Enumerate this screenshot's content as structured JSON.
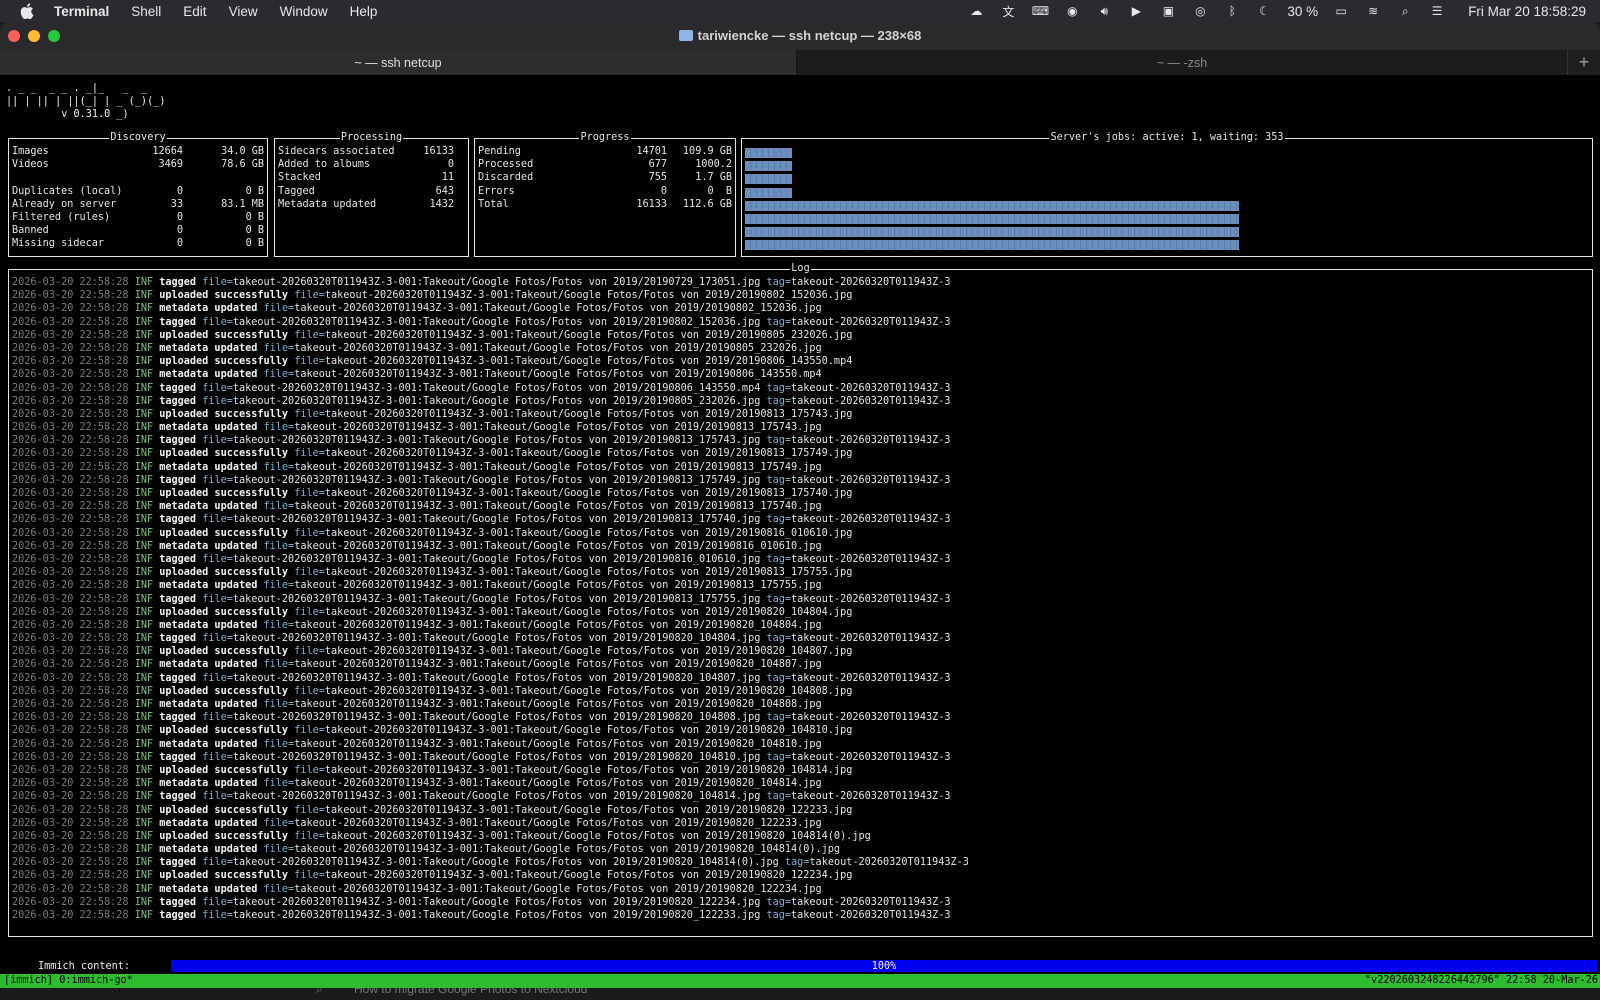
{
  "menubar": {
    "app": "Terminal",
    "items": [
      "Shell",
      "Edit",
      "View",
      "Window",
      "Help"
    ],
    "battery": "30 %",
    "clock": "Fri Mar 20  18:58:29"
  },
  "window": {
    "title": "tariwiencke — ssh netcup — 238×68",
    "tabs": [
      {
        "label": "~ — ssh netcup",
        "active": true
      },
      {
        "label": "~ — -zsh",
        "active": false
      }
    ],
    "add_tab": "+"
  },
  "logo": [
    ". _ _  _ _ . _|_   _  _",
    "|| | || | ||(_| | _ (_)(_)",
    "         v 0.31.0 _)"
  ],
  "discovery": {
    "title": "Discovery",
    "rows": [
      {
        "label": "Images",
        "count": "12664",
        "size": "34.0 GB"
      },
      {
        "label": "Videos",
        "count": "3469",
        "size": "78.6 GB"
      },
      {
        "label": "",
        "count": "",
        "size": ""
      },
      {
        "label": "Duplicates (local)",
        "count": "0",
        "size": "0 B"
      },
      {
        "label": "Already on server",
        "count": "33",
        "size": "83.1 MB"
      },
      {
        "label": "Filtered (rules)",
        "count": "0",
        "size": "0 B"
      },
      {
        "label": "Banned",
        "count": "0",
        "size": "0 B"
      },
      {
        "label": "Missing sidecar",
        "count": "0",
        "size": "0 B"
      }
    ]
  },
  "processing": {
    "title": "Processing",
    "rows": [
      {
        "label": "Sidecars associated",
        "count": "16133"
      },
      {
        "label": "Added to albums",
        "count": "0"
      },
      {
        "label": "Stacked",
        "count": "11"
      },
      {
        "label": "Tagged",
        "count": "643"
      },
      {
        "label": "Metadata updated",
        "count": "1432"
      }
    ]
  },
  "progress": {
    "title": "Progress",
    "rows": [
      {
        "label": "Pending",
        "count": "14701",
        "size": "109.9 GB"
      },
      {
        "label": "Processed",
        "count": "677",
        "size": "1000.2"
      },
      {
        "label": "Discarded",
        "count": "755",
        "size": "1.7 GB"
      },
      {
        "label": "Errors",
        "count": "0",
        "size": "0  B"
      },
      {
        "label": "Total",
        "count": "16133",
        "size": "112.6 GB"
      }
    ]
  },
  "jobs": {
    "title": "Server's jobs: active: 1, waiting: 353",
    "bar_levels": [
      0.095,
      0.095,
      0.095,
      0.095,
      1.0,
      1.0,
      1.0,
      1.0
    ]
  },
  "log": {
    "title": "Log",
    "timestamp": "2026-03-20 22:58:28",
    "level": "INF",
    "lines": [
      {
        "msg": "tagged",
        "file": "takeout-20260320T011943Z-3-001:Takeout/Google Fotos/Fotos von 2019/20190729_173051.jpg",
        "tag": "takeout-20260320T011943Z-3"
      },
      {
        "msg": "uploaded successfully",
        "file": "takeout-20260320T011943Z-3-001:Takeout/Google Fotos/Fotos von 2019/20190802_152036.jpg",
        "tag": ""
      },
      {
        "msg": "metadata updated",
        "file": "takeout-20260320T011943Z-3-001:Takeout/Google Fotos/Fotos von 2019/20190802_152036.jpg",
        "tag": ""
      },
      {
        "msg": "tagged",
        "file": "takeout-20260320T011943Z-3-001:Takeout/Google Fotos/Fotos von 2019/20190802_152036.jpg",
        "tag": "takeout-20260320T011943Z-3"
      },
      {
        "msg": "uploaded successfully",
        "file": "takeout-20260320T011943Z-3-001:Takeout/Google Fotos/Fotos von 2019/20190805_232026.jpg",
        "tag": ""
      },
      {
        "msg": "metadata updated",
        "file": "takeout-20260320T011943Z-3-001:Takeout/Google Fotos/Fotos von 2019/20190805_232026.jpg",
        "tag": ""
      },
      {
        "msg": "uploaded successfully",
        "file": "takeout-20260320T011943Z-3-001:Takeout/Google Fotos/Fotos von 2019/20190806_143550.mp4",
        "tag": ""
      },
      {
        "msg": "metadata updated",
        "file": "takeout-20260320T011943Z-3-001:Takeout/Google Fotos/Fotos von 2019/20190806_143550.mp4",
        "tag": ""
      },
      {
        "msg": "tagged",
        "file": "takeout-20260320T011943Z-3-001:Takeout/Google Fotos/Fotos von 2019/20190806_143550.mp4",
        "tag": "takeout-20260320T011943Z-3"
      },
      {
        "msg": "tagged",
        "file": "takeout-20260320T011943Z-3-001:Takeout/Google Fotos/Fotos von 2019/20190805_232026.jpg",
        "tag": "takeout-20260320T011943Z-3"
      },
      {
        "msg": "uploaded successfully",
        "file": "takeout-20260320T011943Z-3-001:Takeout/Google Fotos/Fotos von 2019/20190813_175743.jpg",
        "tag": ""
      },
      {
        "msg": "metadata updated",
        "file": "takeout-20260320T011943Z-3-001:Takeout/Google Fotos/Fotos von 2019/20190813_175743.jpg",
        "tag": ""
      },
      {
        "msg": "tagged",
        "file": "takeout-20260320T011943Z-3-001:Takeout/Google Fotos/Fotos von 2019/20190813_175743.jpg",
        "tag": "takeout-20260320T011943Z-3"
      },
      {
        "msg": "uploaded successfully",
        "file": "takeout-20260320T011943Z-3-001:Takeout/Google Fotos/Fotos von 2019/20190813_175749.jpg",
        "tag": ""
      },
      {
        "msg": "metadata updated",
        "file": "takeout-20260320T011943Z-3-001:Takeout/Google Fotos/Fotos von 2019/20190813_175749.jpg",
        "tag": ""
      },
      {
        "msg": "tagged",
        "file": "takeout-20260320T011943Z-3-001:Takeout/Google Fotos/Fotos von 2019/20190813_175749.jpg",
        "tag": "takeout-20260320T011943Z-3"
      },
      {
        "msg": "uploaded successfully",
        "file": "takeout-20260320T011943Z-3-001:Takeout/Google Fotos/Fotos von 2019/20190813_175740.jpg",
        "tag": ""
      },
      {
        "msg": "metadata updated",
        "file": "takeout-20260320T011943Z-3-001:Takeout/Google Fotos/Fotos von 2019/20190813_175740.jpg",
        "tag": ""
      },
      {
        "msg": "tagged",
        "file": "takeout-20260320T011943Z-3-001:Takeout/Google Fotos/Fotos von 2019/20190813_175740.jpg",
        "tag": "takeout-20260320T011943Z-3"
      },
      {
        "msg": "uploaded successfully",
        "file": "takeout-20260320T011943Z-3-001:Takeout/Google Fotos/Fotos von 2019/20190816_010610.jpg",
        "tag": ""
      },
      {
        "msg": "metadata updated",
        "file": "takeout-20260320T011943Z-3-001:Takeout/Google Fotos/Fotos von 2019/20190816_010610.jpg",
        "tag": ""
      },
      {
        "msg": "tagged",
        "file": "takeout-20260320T011943Z-3-001:Takeout/Google Fotos/Fotos von 2019/20190816_010610.jpg",
        "tag": "takeout-20260320T011943Z-3"
      },
      {
        "msg": "uploaded successfully",
        "file": "takeout-20260320T011943Z-3-001:Takeout/Google Fotos/Fotos von 2019/20190813_175755.jpg",
        "tag": ""
      },
      {
        "msg": "metadata updated",
        "file": "takeout-20260320T011943Z-3-001:Takeout/Google Fotos/Fotos von 2019/20190813_175755.jpg",
        "tag": ""
      },
      {
        "msg": "tagged",
        "file": "takeout-20260320T011943Z-3-001:Takeout/Google Fotos/Fotos von 2019/20190813_175755.jpg",
        "tag": "takeout-20260320T011943Z-3"
      },
      {
        "msg": "uploaded successfully",
        "file": "takeout-20260320T011943Z-3-001:Takeout/Google Fotos/Fotos von 2019/20190820_104804.jpg",
        "tag": ""
      },
      {
        "msg": "metadata updated",
        "file": "takeout-20260320T011943Z-3-001:Takeout/Google Fotos/Fotos von 2019/20190820_104804.jpg",
        "tag": ""
      },
      {
        "msg": "tagged",
        "file": "takeout-20260320T011943Z-3-001:Takeout/Google Fotos/Fotos von 2019/20190820_104804.jpg",
        "tag": "takeout-20260320T011943Z-3"
      },
      {
        "msg": "uploaded successfully",
        "file": "takeout-20260320T011943Z-3-001:Takeout/Google Fotos/Fotos von 2019/20190820_104807.jpg",
        "tag": ""
      },
      {
        "msg": "metadata updated",
        "file": "takeout-20260320T011943Z-3-001:Takeout/Google Fotos/Fotos von 2019/20190820_104807.jpg",
        "tag": ""
      },
      {
        "msg": "tagged",
        "file": "takeout-20260320T011943Z-3-001:Takeout/Google Fotos/Fotos von 2019/20190820_104807.jpg",
        "tag": "takeout-20260320T011943Z-3"
      },
      {
        "msg": "uploaded successfully",
        "file": "takeout-20260320T011943Z-3-001:Takeout/Google Fotos/Fotos von 2019/20190820_104808.jpg",
        "tag": ""
      },
      {
        "msg": "metadata updated",
        "file": "takeout-20260320T011943Z-3-001:Takeout/Google Fotos/Fotos von 2019/20190820_104808.jpg",
        "tag": ""
      },
      {
        "msg": "tagged",
        "file": "takeout-20260320T011943Z-3-001:Takeout/Google Fotos/Fotos von 2019/20190820_104808.jpg",
        "tag": "takeout-20260320T011943Z-3"
      },
      {
        "msg": "uploaded successfully",
        "file": "takeout-20260320T011943Z-3-001:Takeout/Google Fotos/Fotos von 2019/20190820_104810.jpg",
        "tag": ""
      },
      {
        "msg": "metadata updated",
        "file": "takeout-20260320T011943Z-3-001:Takeout/Google Fotos/Fotos von 2019/20190820_104810.jpg",
        "tag": ""
      },
      {
        "msg": "tagged",
        "file": "takeout-20260320T011943Z-3-001:Takeout/Google Fotos/Fotos von 2019/20190820_104810.jpg",
        "tag": "takeout-20260320T011943Z-3"
      },
      {
        "msg": "uploaded successfully",
        "file": "takeout-20260320T011943Z-3-001:Takeout/Google Fotos/Fotos von 2019/20190820_104814.jpg",
        "tag": ""
      },
      {
        "msg": "metadata updated",
        "file": "takeout-20260320T011943Z-3-001:Takeout/Google Fotos/Fotos von 2019/20190820_104814.jpg",
        "tag": ""
      },
      {
        "msg": "tagged",
        "file": "takeout-20260320T011943Z-3-001:Takeout/Google Fotos/Fotos von 2019/20190820_104814.jpg",
        "tag": "takeout-20260320T011943Z-3"
      },
      {
        "msg": "uploaded successfully",
        "file": "takeout-20260320T011943Z-3-001:Takeout/Google Fotos/Fotos von 2019/20190820_122233.jpg",
        "tag": ""
      },
      {
        "msg": "metadata updated",
        "file": "takeout-20260320T011943Z-3-001:Takeout/Google Fotos/Fotos von 2019/20190820_122233.jpg",
        "tag": ""
      },
      {
        "msg": "uploaded successfully",
        "file": "takeout-20260320T011943Z-3-001:Takeout/Google Fotos/Fotos von 2019/20190820_104814(0).jpg",
        "tag": ""
      },
      {
        "msg": "metadata updated",
        "file": "takeout-20260320T011943Z-3-001:Takeout/Google Fotos/Fotos von 2019/20190820_104814(0).jpg",
        "tag": ""
      },
      {
        "msg": "tagged",
        "file": "takeout-20260320T011943Z-3-001:Takeout/Google Fotos/Fotos von 2019/20190820_104814(0).jpg",
        "tag": "takeout-20260320T011943Z-3"
      },
      {
        "msg": "uploaded successfully",
        "file": "takeout-20260320T011943Z-3-001:Takeout/Google Fotos/Fotos von 2019/20190820_122234.jpg",
        "tag": ""
      },
      {
        "msg": "metadata updated",
        "file": "takeout-20260320T011943Z-3-001:Takeout/Google Fotos/Fotos von 2019/20190820_122234.jpg",
        "tag": ""
      },
      {
        "msg": "tagged",
        "file": "takeout-20260320T011943Z-3-001:Takeout/Google Fotos/Fotos von 2019/20190820_122234.jpg",
        "tag": "takeout-20260320T011943Z-3"
      },
      {
        "msg": "tagged",
        "file": "takeout-20260320T011943Z-3-001:Takeout/Google Fotos/Fotos von 2019/20190820_122233.jpg",
        "tag": "takeout-20260320T011943Z-3"
      }
    ]
  },
  "content_progress": {
    "label": "Immich content:",
    "percent_text": "100%",
    "fraction": 1.0
  },
  "tmux": {
    "left": "[immich] 0:immich-go*",
    "right": "\"v2202603248226442796\" 22:58 20-Mar-26"
  },
  "behind_window": {
    "text": "How to migrate Google Photos to Nextcloud"
  }
}
